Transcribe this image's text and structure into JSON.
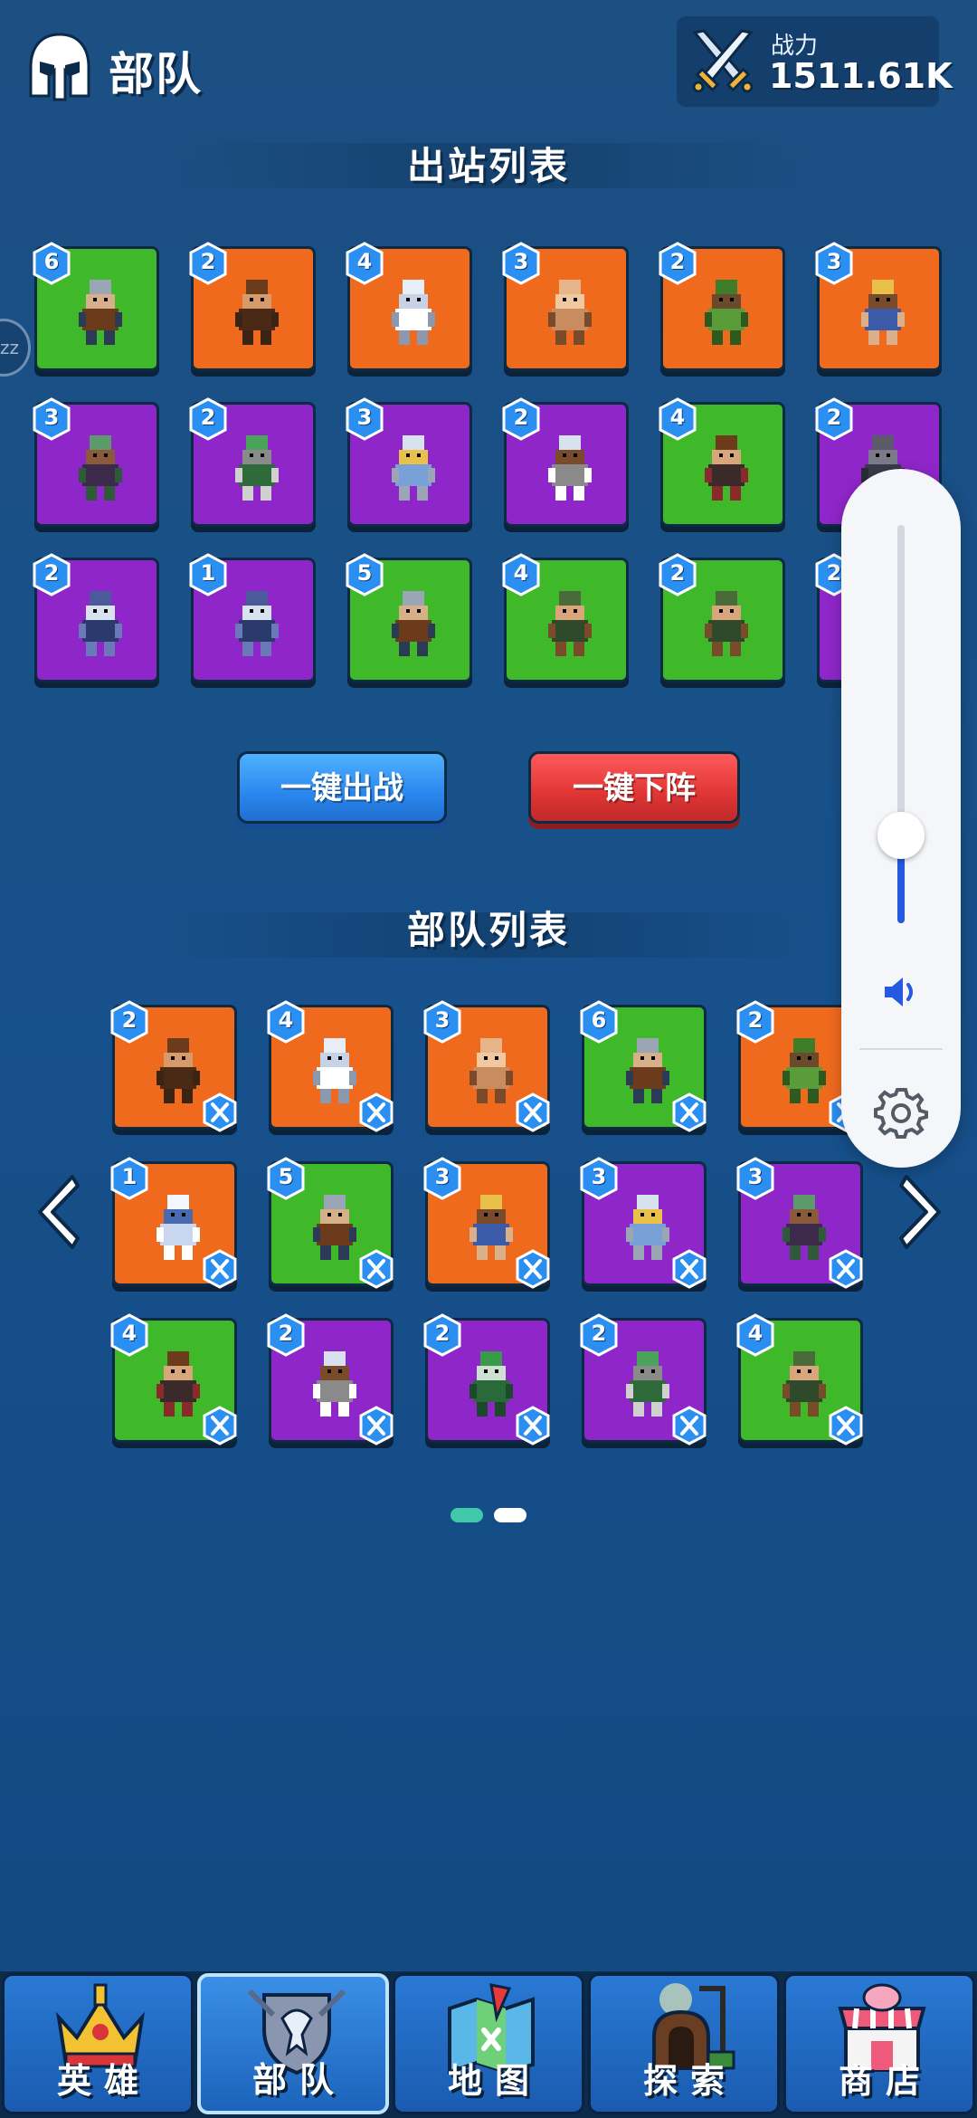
{
  "header": {
    "title": "部队",
    "power_label": "战力",
    "power_value": "1511.61K"
  },
  "deploy_section": {
    "title": "出站列表",
    "units": [
      {
        "level": "6",
        "color": "green",
        "unit": "dwarf-axe"
      },
      {
        "level": "2",
        "color": "orange",
        "unit": "caveman"
      },
      {
        "level": "4",
        "color": "orange",
        "unit": "angel"
      },
      {
        "level": "3",
        "color": "orange",
        "unit": "cyclops"
      },
      {
        "level": "2",
        "color": "orange",
        "unit": "treant"
      },
      {
        "level": "3",
        "color": "orange",
        "unit": "archer"
      },
      {
        "level": "3",
        "color": "purple",
        "unit": "troll"
      },
      {
        "level": "2",
        "color": "purple",
        "unit": "goblin"
      },
      {
        "level": "3",
        "color": "purple",
        "unit": "skeleton-mage"
      },
      {
        "level": "2",
        "color": "purple",
        "unit": "skeleton-archer"
      },
      {
        "level": "4",
        "color": "green",
        "unit": "shield-warrior"
      },
      {
        "level": "2",
        "color": "purple",
        "unit": "bat"
      },
      {
        "level": "2",
        "color": "purple",
        "unit": "hooded-skeleton"
      },
      {
        "level": "1",
        "color": "purple",
        "unit": "hooded-skeleton"
      },
      {
        "level": "5",
        "color": "green",
        "unit": "dwarf-axe"
      },
      {
        "level": "4",
        "color": "green",
        "unit": "hooded-archer"
      },
      {
        "level": "2",
        "color": "green",
        "unit": "hooded-archer"
      },
      {
        "level": "2",
        "color": "purple",
        "unit": "ghost"
      }
    ]
  },
  "buttons": {
    "deploy_all": "一键出战",
    "remove_all": "一键下阵"
  },
  "army_section": {
    "title": "部队列表",
    "units": [
      {
        "level": "2",
        "color": "orange",
        "unit": "caveman"
      },
      {
        "level": "4",
        "color": "orange",
        "unit": "angel"
      },
      {
        "level": "3",
        "color": "orange",
        "unit": "cyclops"
      },
      {
        "level": "6",
        "color": "green",
        "unit": "dwarf-axe"
      },
      {
        "level": "2",
        "color": "orange",
        "unit": "treant"
      },
      {
        "level": "1",
        "color": "orange",
        "unit": "yeti"
      },
      {
        "level": "5",
        "color": "green",
        "unit": "dwarf-axe"
      },
      {
        "level": "3",
        "color": "orange",
        "unit": "archer"
      },
      {
        "level": "3",
        "color": "purple",
        "unit": "skeleton-mage"
      },
      {
        "level": "3",
        "color": "purple",
        "unit": "troll"
      },
      {
        "level": "4",
        "color": "green",
        "unit": "shield-warrior"
      },
      {
        "level": "2",
        "color": "purple",
        "unit": "skeleton-archer"
      },
      {
        "level": "2",
        "color": "purple",
        "unit": "zombie"
      },
      {
        "level": "2",
        "color": "purple",
        "unit": "goblin"
      },
      {
        "level": "4",
        "color": "green",
        "unit": "hooded-archer"
      }
    ],
    "page_indicator": {
      "pages": 2,
      "current": 1
    }
  },
  "volume_overlay": {
    "level": 0.22,
    "icon": "speaker-icon",
    "settings_icon": "gear-icon"
  },
  "bottom_nav": [
    {
      "label": "英雄",
      "icon": "crown-icon",
      "active": false
    },
    {
      "label": "部队",
      "icon": "eagle-shield-icon",
      "active": true
    },
    {
      "label": "地图",
      "icon": "map-icon",
      "active": false
    },
    {
      "label": "探索",
      "icon": "mine-icon",
      "active": false
    },
    {
      "label": "商店",
      "icon": "shop-icon",
      "active": false
    }
  ],
  "colors": {
    "green": "#3fb92a",
    "orange": "#f06a1e",
    "purple": "#8f26c9",
    "badge": "#2b8ff2"
  }
}
